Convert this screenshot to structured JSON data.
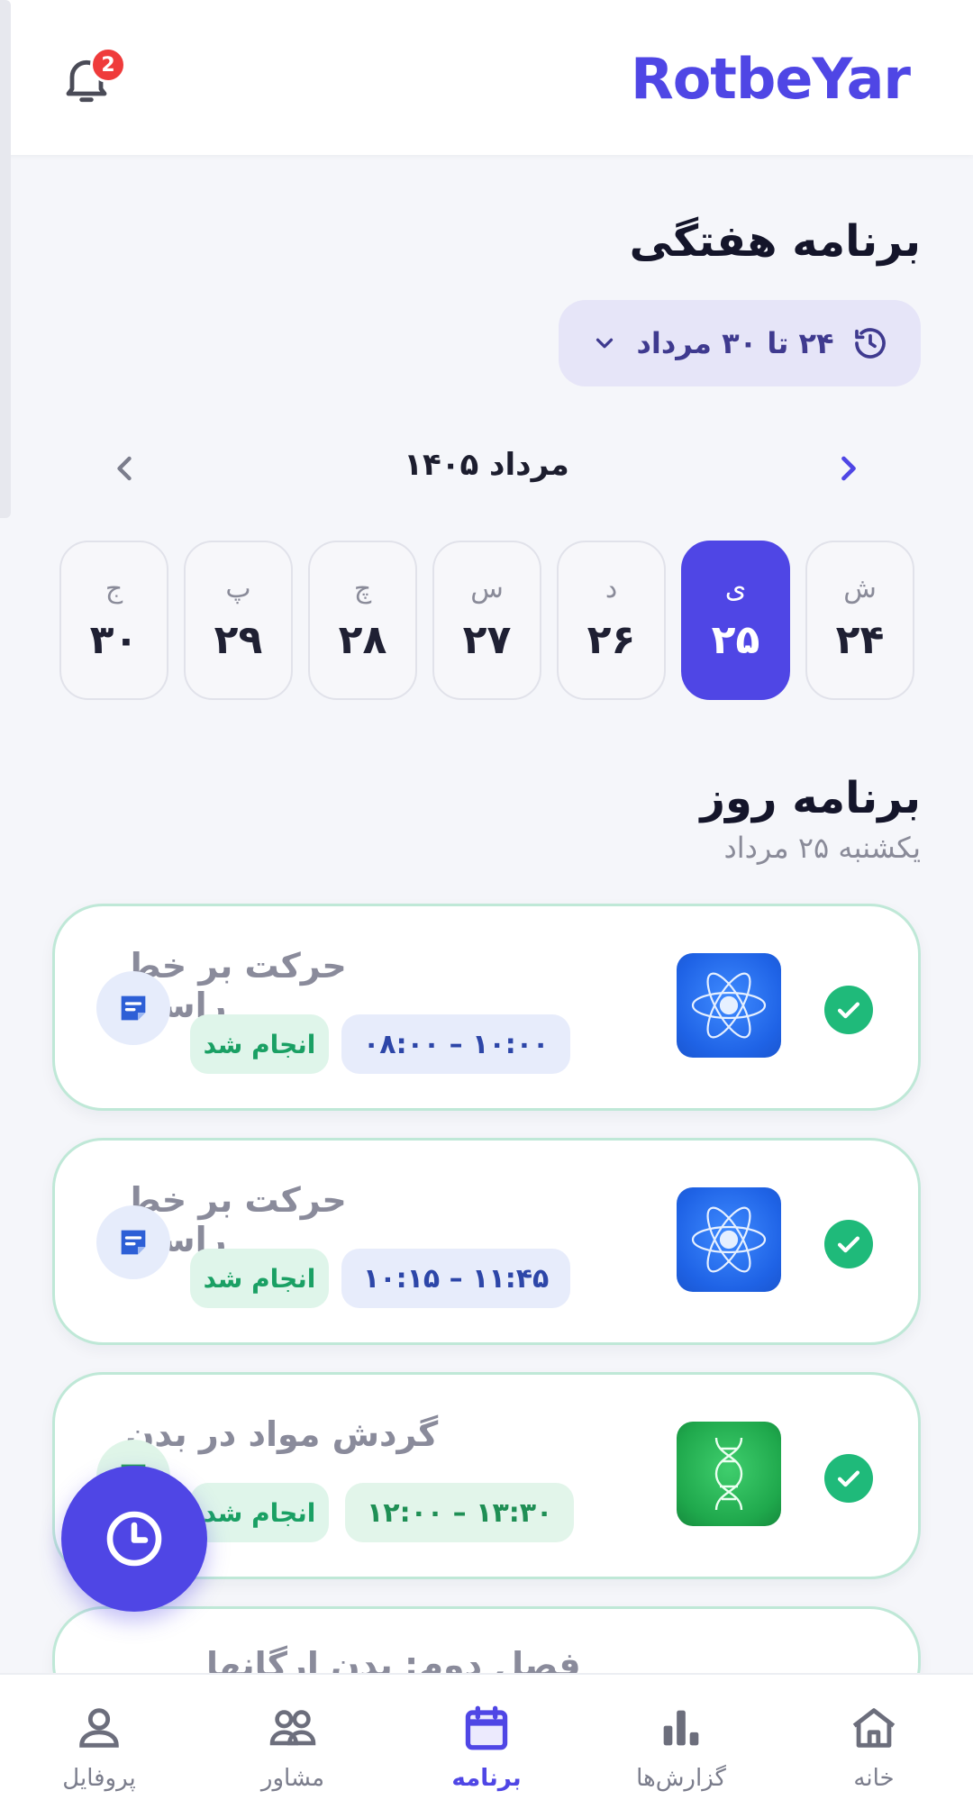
{
  "header": {
    "logo_text": "RotbeYar",
    "notification_count": "2",
    "brand_color": "#4f46e5"
  },
  "weekly": {
    "title": "برنامه هفتگی",
    "range_label": "۲۴ تا ۳۰ مرداد",
    "month_label": "مرداد ۱۴۰۵"
  },
  "days": [
    {
      "name": "ش",
      "num": "۲۴",
      "active": false
    },
    {
      "name": "ی",
      "num": "۲۵",
      "active": true
    },
    {
      "name": "د",
      "num": "۲۶",
      "active": false
    },
    {
      "name": "س",
      "num": "۲۷",
      "active": false
    },
    {
      "name": "چ",
      "num": "۲۸",
      "active": false
    },
    {
      "name": "پ",
      "num": "۲۹",
      "active": false
    },
    {
      "name": "ج",
      "num": "۳۰",
      "active": false
    }
  ],
  "daily": {
    "title": "برنامه روز",
    "subtitle": "یکشنبه ۲۵ مرداد"
  },
  "tasks": [
    {
      "title": "حرکت بر خط راست",
      "time": "۰۸:۰۰ – ۱۰:۰۰",
      "status": "انجام شد",
      "thumb": "atom-icon",
      "theme": "blue"
    },
    {
      "title": "حرکت بر خط راست",
      "time": "۱۰:۱۵ – ۱۱:۴۵",
      "status": "انجام شد",
      "thumb": "atom-icon",
      "theme": "blue"
    },
    {
      "title": "گردش مواد در بدن",
      "time": "۱۲:۰۰ – ۱۳:۳۰",
      "status": "انجام شد",
      "thumb": "dna-icon",
      "theme": "green"
    },
    {
      "title": "فصل دوم: بدن ارگانها",
      "time": "",
      "status": "",
      "thumb": "",
      "theme": "blue"
    }
  ],
  "bottom_nav": [
    {
      "label": "خانه",
      "icon": "home-icon",
      "active": false
    },
    {
      "label": "گزارش‌ها",
      "icon": "bar-chart-icon",
      "active": false
    },
    {
      "label": "برنامه",
      "icon": "calendar-icon",
      "active": true
    },
    {
      "label": "مشاور",
      "icon": "users-icon",
      "active": false
    },
    {
      "label": "پروفایل",
      "icon": "user-icon",
      "active": false
    }
  ]
}
